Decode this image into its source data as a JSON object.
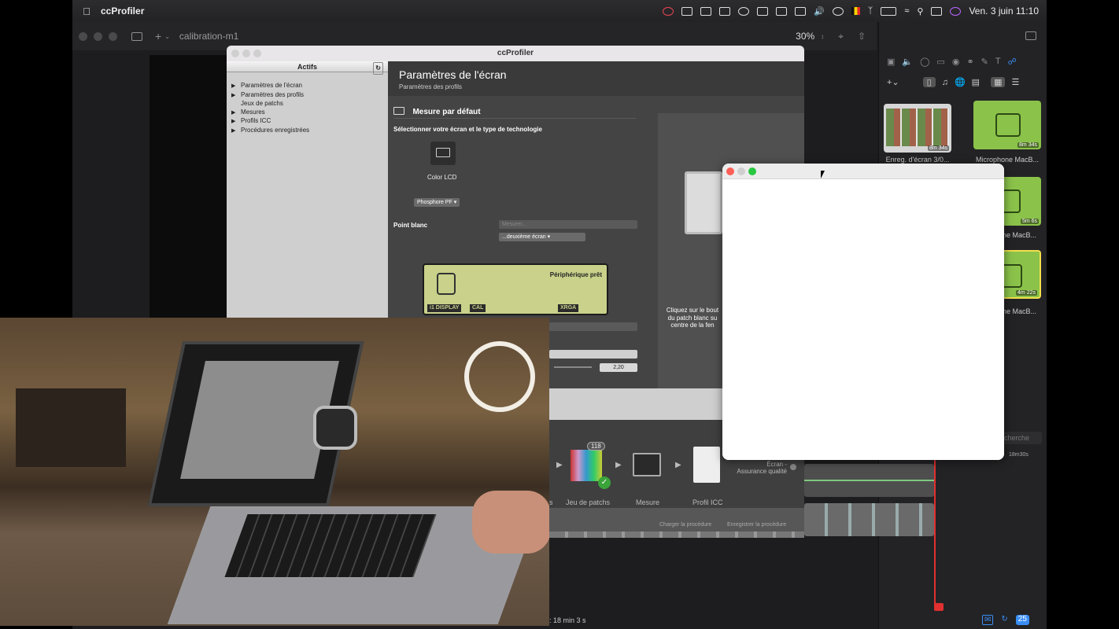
{
  "menubar": {
    "apple_icon": "apple-logo",
    "app_name": "ccProfiler",
    "datetime": "Ven. 3 juin  11:10"
  },
  "screenflow": {
    "document_title": "calibration-m1",
    "zoom": "30%",
    "media": [
      {
        "label": "Enreg. d'écran 3/0...",
        "duration": "8m 34s"
      },
      {
        "label": "Microphone MacB...",
        "duration": "8m 34s"
      },
      {
        "label": "hone MacB...",
        "duration": "5m 6s"
      },
      {
        "label": "hone MacB...",
        "duration": "4m 22s"
      }
    ],
    "search_placeholder": "cherche",
    "timeline_marker": "18m30s",
    "total_duration": ": 18 min 3 s",
    "counter_badge": "25"
  },
  "ccprofiler": {
    "window_title": "ccProfiler",
    "sidebar": {
      "header": "Actifs",
      "items": [
        {
          "label": "Paramètres de l'écran",
          "expandable": true
        },
        {
          "label": "Paramètres des profils",
          "expandable": true
        },
        {
          "label": "Jeux de patchs",
          "expandable": false
        },
        {
          "label": "Mesures",
          "expandable": true
        },
        {
          "label": "Profils ICC",
          "expandable": true
        },
        {
          "label": "Procédures enregistrées",
          "expandable": true
        }
      ]
    },
    "main": {
      "title": "Paramètres de l'écran",
      "subtitle": "Paramètres des profils",
      "section_title": "Mesure par défaut",
      "select_prompt": "Sélectionner votre écran et le type de technologie",
      "display_type": "Color LCD",
      "phosphor_select": "Phosphore PF",
      "white_point_label": "Point blanc",
      "measure_select": "Mesurer...",
      "second_screen_select": "...deuxième écran",
      "device_status": "Périphérique prêt",
      "lcd_tags": [
        "i1 DISPLAY",
        "CAL",
        "XRGA"
      ],
      "gamma_value": "2,20",
      "hint_text": [
        "Cliquez sur le bout",
        "du patch blanc su",
        "centre de la fen"
      ]
    },
    "procedure": {
      "patch_count": "118",
      "steps": [
        "s",
        "Jeu de patchs",
        "Mesure",
        "Profil ICC"
      ],
      "screen_quality": [
        "Écran -",
        "Assurance qualité"
      ],
      "load_label": "Charger la procédure",
      "save_label": "Enregistrer la procédure"
    }
  },
  "colors": {
    "accent_green": "#8bc34a",
    "lcd_green": "#c9d18a",
    "playhead_red": "#e03030",
    "close_red": "#fe5f57",
    "min_gray": "#cfcfcf",
    "max_green": "#28c840"
  }
}
